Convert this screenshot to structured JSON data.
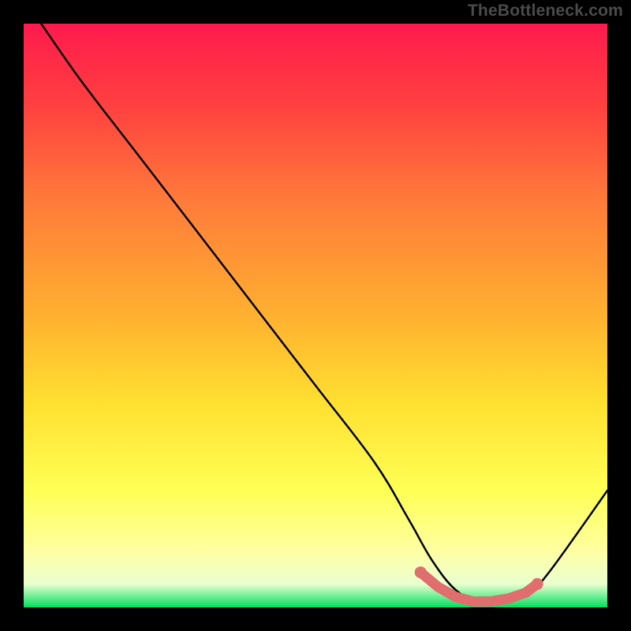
{
  "watermark": "TheBottleneck.com",
  "colors": {
    "background": "#000000",
    "grad_top": "#ff1a4d",
    "grad_1": "#ff4040",
    "grad_2": "#ff7a3a",
    "grad_3": "#ffb030",
    "grad_4": "#ffe030",
    "grad_5": "#ffff55",
    "grad_6": "#ffffa0",
    "grad_7": "#eaffd0",
    "grad_bottom": "#00e060",
    "curve": "#000000",
    "marker_stroke": "#e06e6e",
    "marker_fill": "#e06e6e"
  },
  "chart_data": {
    "type": "line",
    "title": "",
    "xlabel": "",
    "ylabel": "",
    "xlim": [
      0,
      100
    ],
    "ylim": [
      0,
      100
    ],
    "series": [
      {
        "name": "bottleneck-curve",
        "x": [
          3,
          10,
          20,
          30,
          40,
          50,
          60,
          66,
          70,
          74,
          78,
          82,
          86,
          90,
          100
        ],
        "y": [
          100,
          90,
          77,
          64,
          51,
          38,
          25,
          15,
          8,
          3,
          1,
          1,
          2,
          6,
          20
        ]
      }
    ],
    "markers": {
      "name": "optimal-range",
      "x": [
        68,
        71,
        74,
        77,
        80,
        83,
        86,
        88
      ],
      "y": [
        6,
        3.5,
        1.8,
        1,
        1,
        1.5,
        2.5,
        4
      ]
    }
  }
}
